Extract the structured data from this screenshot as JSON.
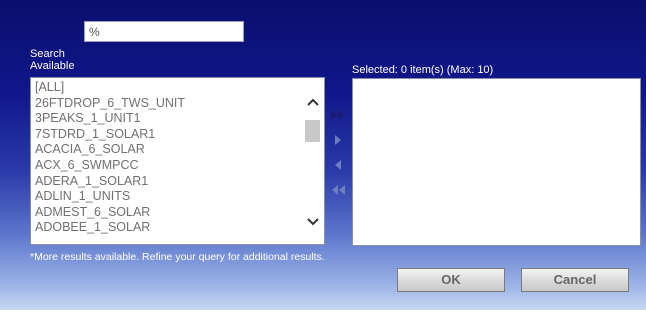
{
  "search": {
    "value": "%",
    "label": "Search"
  },
  "available": {
    "label": "Available",
    "items": [
      "[ALL]",
      "26FTDROP_6_TWS_UNIT",
      "3PEAKS_1_UNIT1",
      "7STDRD_1_SOLAR1",
      "ACACIA_6_SOLAR",
      "ACX_6_SWMPCC",
      "ADERA_1_SOLAR1",
      "ADLIN_1_UNITS",
      "ADMEST_6_SOLAR",
      "ADOBEE_1_SOLAR"
    ]
  },
  "selected": {
    "label": "Selected: 0 item(s) (Max: 10)",
    "items": []
  },
  "transfer": {
    "add_all_icon": "double-right-arrow-icon",
    "add_icon": "right-arrow-icon",
    "remove_icon": "left-arrow-icon",
    "remove_all_icon": "double-left-arrow-icon",
    "active_color": "#1a1a6e",
    "disabled_color": "#6e7fbf"
  },
  "note": "*More results available. Refine your query for additional results.",
  "buttons": {
    "ok": "OK",
    "cancel": "Cancel"
  },
  "scrollbar": {
    "up_icon": "chevron-up-icon",
    "down_icon": "chevron-down-icon"
  }
}
